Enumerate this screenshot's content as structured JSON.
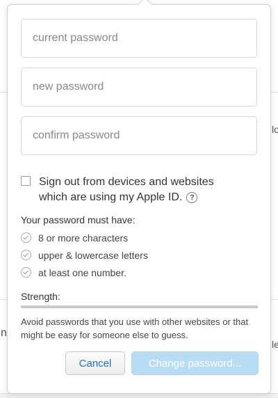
{
  "background": {
    "fragments": [
      "lo",
      "n",
      "le"
    ]
  },
  "form": {
    "current_password_placeholder": "current password",
    "new_password_placeholder": "new password",
    "confirm_password_placeholder": "confirm password",
    "signout_label": "Sign out from devices and websites which are using my Apple ID.",
    "help_icon": "?",
    "requirements_title": "Your password must have:",
    "requirements": [
      "8 or more characters",
      "upper & lowercase letters",
      "at least one number."
    ],
    "strength_label": "Strength:",
    "strength_value": 0,
    "advice": "Avoid passwords that you use with other websites or that might be easy for someone else to guess.",
    "cancel_label": "Cancel",
    "change_label": "Change password..."
  },
  "colors": {
    "link_blue": "#1a6fc4",
    "primary_disabled": "#b9dcf5"
  }
}
